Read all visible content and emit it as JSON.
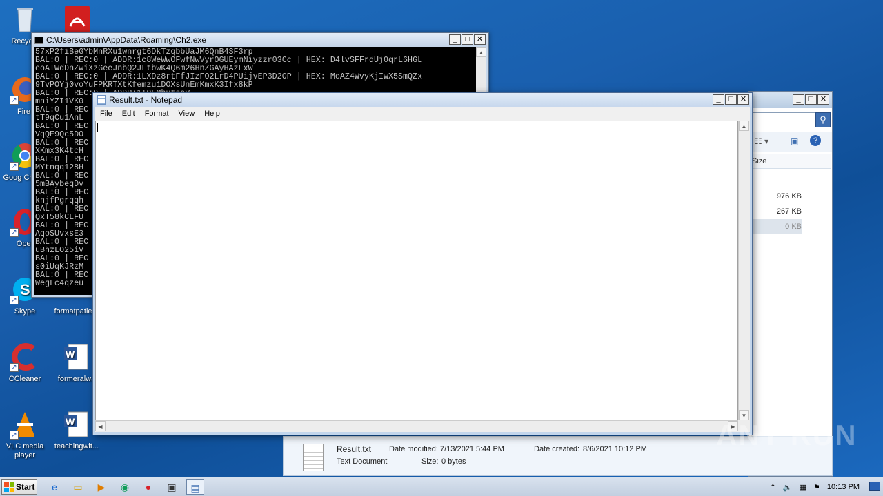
{
  "desktop": {
    "icons": [
      {
        "name": "recycle-bin",
        "label": "Recycle"
      },
      {
        "name": "acrobat",
        "label": ""
      },
      {
        "name": "firefox",
        "label": "Firef"
      },
      {
        "name": "chrome",
        "label": "Goog Chrom"
      },
      {
        "name": "opera",
        "label": "Oper"
      },
      {
        "name": "skype",
        "label": "Skype"
      },
      {
        "name": "formatpatie",
        "label": "formatpatie"
      },
      {
        "name": "ccleaner",
        "label": "CCleaner"
      },
      {
        "name": "formeralwa",
        "label": "formeralwa"
      },
      {
        "name": "vlc",
        "label": "VLC media player"
      },
      {
        "name": "teachingwit",
        "label": "teachingwit..."
      }
    ]
  },
  "console": {
    "title": "C:\\Users\\admin\\AppData\\Roaming\\Ch2.exe",
    "text": "57xP2fiBeGYbMnRXu1wnrgt6DkTzqbbUaJM6QnB4SF3rp\nBAL:0 | REC:0 | ADDR:1c8WeWwOFwfNwVyrOGUEymNiyzzr03Cc | HEX: D4lvSFFrdUj0qrL6HGL\neoATWdDnZwiXzGeeJnbQ2JLtbwK4Q6m26HnZGAyHAzFxW\nBAL:0 | REC:0 | ADDR:1LXDz8rtFfJIzFO2LrD4PUijvEP3D2OP | HEX: MoAZ4WvyKjIwX5SmQZx\n9TvPOYj0voYuFPKRTXtKfemzu1DOXsUnEmKmxK3Ifx8kP\nBAL:0 | REC:0 | ADDR:1TOFMhuteaV...\nmniYZI1VK0\nBAL:0 | REC\ntT9qCu1AnL\nBAL:0 | REC\nVqQE9Qc5DO\nBAL:0 | REC\nXKmx3K4tcH\nBAL:0 | REC\nMYtnqq128H\nBAL:0 | REC\n5mBAybeqDv\nBAL:0 | REC\nknjfPgrqqh\nBAL:0 | REC\nQxT58kCLFU\nBAL:0 | REC\nAqoSUvxsE3\nBAL:0 | REC\nuBhzLO25iV\nBAL:0 | REC\ns0iUqKJRzM\nBAL:0 | REC\nWegLc4qzeu"
  },
  "notepad": {
    "title": "Result.txt - Notepad",
    "menu": [
      "File",
      "Edit",
      "Format",
      "View",
      "Help"
    ],
    "content": ""
  },
  "explorer": {
    "column_size": "Size",
    "sizes": [
      "976 KB",
      "267 KB",
      "0 KB"
    ]
  },
  "details": {
    "filename": "Result.txt",
    "filetype": "Text Document",
    "modified_label": "Date modified:",
    "modified_value": "7/13/2021 5:44 PM",
    "created_label": "Date created:",
    "created_value": "8/6/2021 10:12 PM",
    "size_label": "Size:",
    "size_value": "0 bytes"
  },
  "watermark": "ANY RUN",
  "taskbar": {
    "start_label": "Start",
    "clock": "10:13 PM"
  },
  "colors": {
    "desktop_blue": "#1a5fae",
    "console_bg": "#000000",
    "console_text": "#c0c0c0"
  }
}
